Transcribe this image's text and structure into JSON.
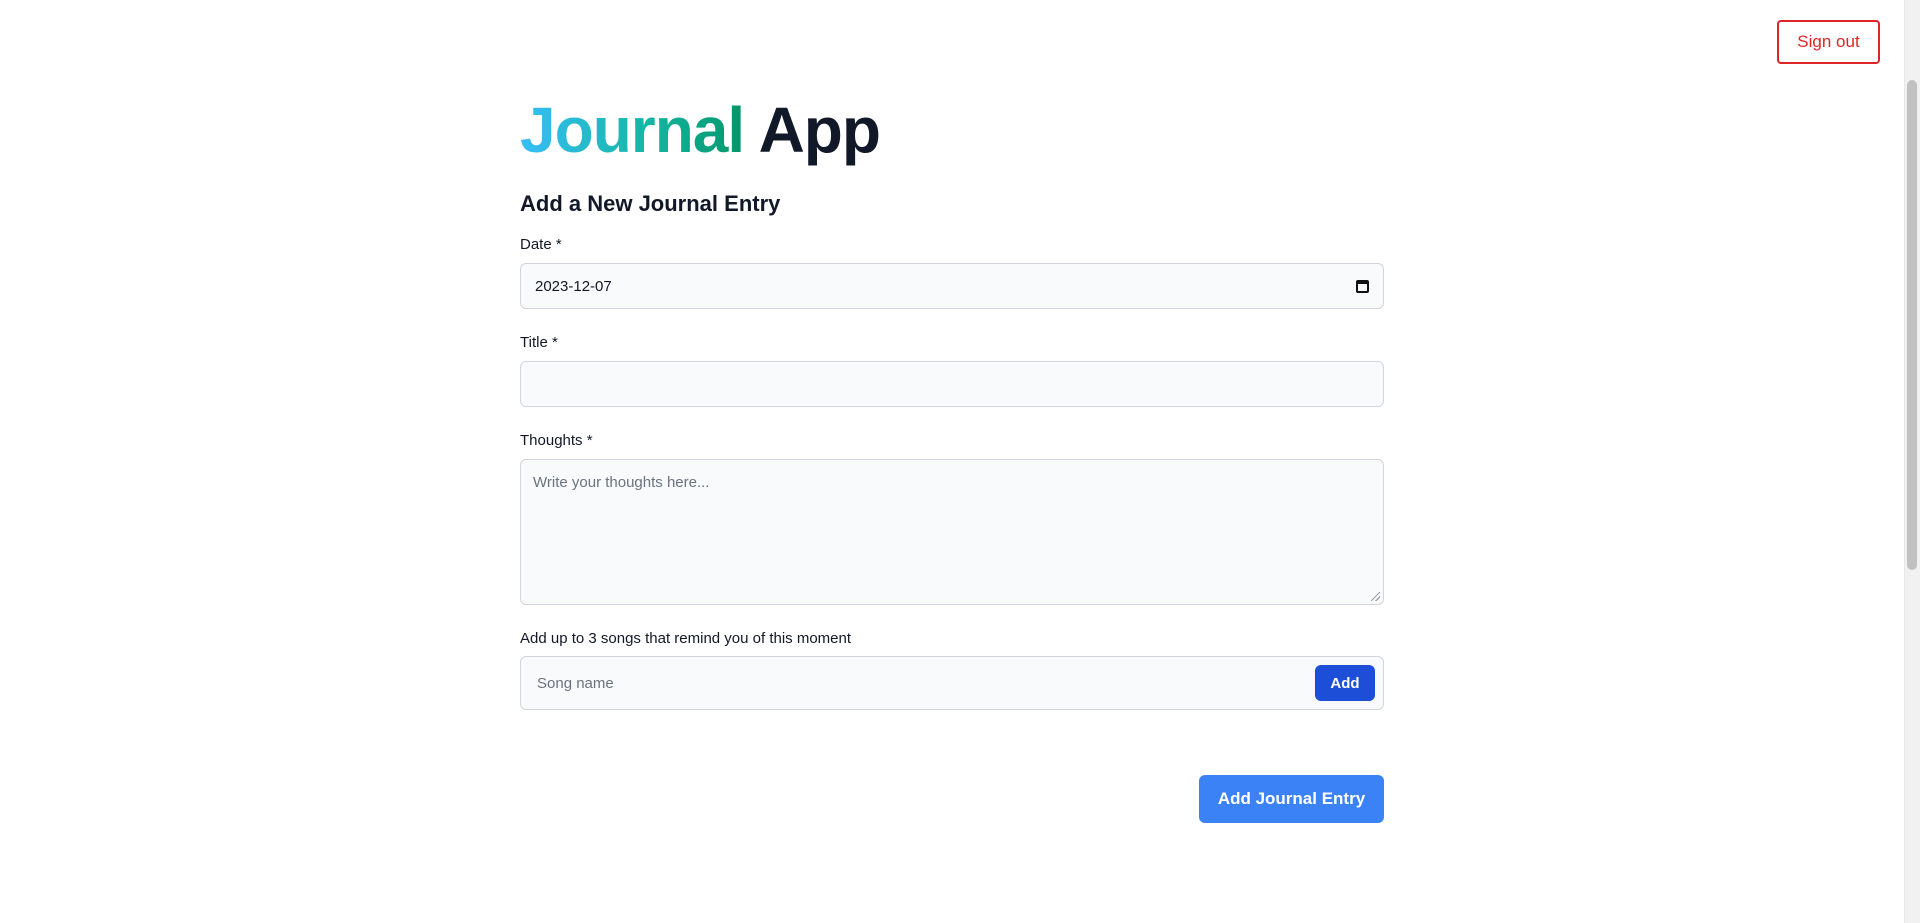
{
  "header": {
    "signout_label": "Sign out"
  },
  "brand": {
    "part1": "Journal",
    "part2": "App"
  },
  "form": {
    "title": "Add a New Journal Entry",
    "date_label": "Date *",
    "date_value": "2023-12-07",
    "title_label": "Title *",
    "title_value": "",
    "thoughts_label": "Thoughts *",
    "thoughts_placeholder": "Write your thoughts here...",
    "songs_label": "Add up to 3 songs that remind you of this moment",
    "song_placeholder": "Song name",
    "song_add_label": "Add",
    "submit_label": "Add Journal Entry"
  },
  "colors": {
    "brand_gradient_start": "#38bdf8",
    "brand_gradient_end": "#059669",
    "signout": "#dc2626",
    "primary": "#3b82f6",
    "primary_dark": "#1d4ed8"
  }
}
